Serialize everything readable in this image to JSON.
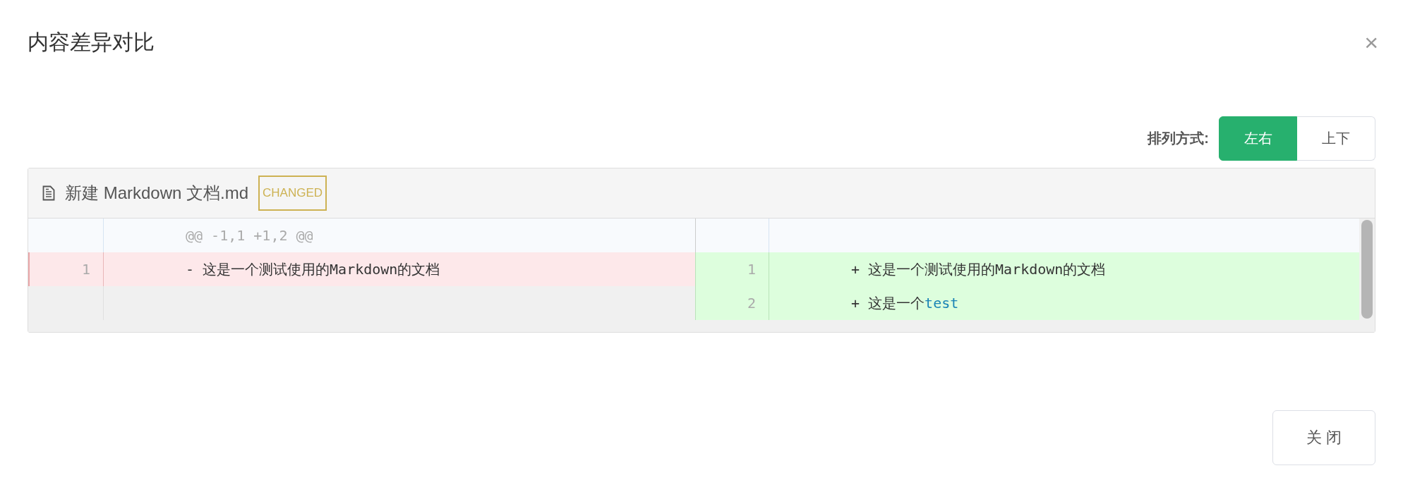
{
  "dialog": {
    "title": "内容差异对比",
    "close_icon": "×"
  },
  "layout_toggle": {
    "label": "排列方式:",
    "options": [
      {
        "label": "左右",
        "selected": true
      },
      {
        "label": "上下",
        "selected": false
      }
    ]
  },
  "file": {
    "name": "新建 Markdown 文档.md",
    "status": "CHANGED"
  },
  "rows": [
    {
      "left": {
        "kind": "hunk",
        "segments": [
          {
            "text": "@@ -1,1 +1,2 @@",
            "highlight": false
          }
        ]
      },
      "right": {
        "kind": "hunk"
      }
    },
    {
      "left": {
        "kind": "removed",
        "number": "1",
        "segments": [
          {
            "text": "- 这是一个测试使用的Markdown的文档",
            "highlight": false
          }
        ]
      },
      "right": {
        "kind": "added",
        "number": "1",
        "segments": [
          {
            "text": "+ 这是一个测试使用的Markdown的文档",
            "highlight": false
          }
        ]
      }
    },
    {
      "left": {
        "kind": "empty"
      },
      "right": {
        "kind": "added",
        "number": "2",
        "segments": [
          {
            "text": "+ 这是一个",
            "highlight": false
          },
          {
            "text": "test",
            "highlight": true
          }
        ]
      }
    }
  ],
  "footer": {
    "button": "关 闭"
  }
}
